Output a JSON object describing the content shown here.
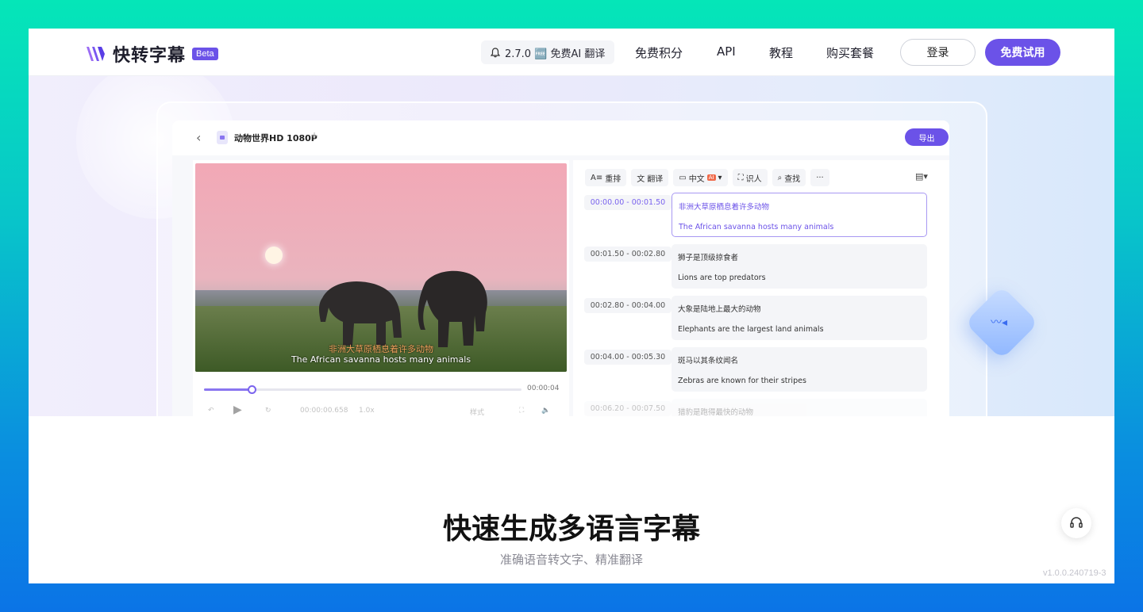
{
  "brand": {
    "name": "快转字幕",
    "badge": "Beta"
  },
  "nav": {
    "release": {
      "icon": "bell-icon",
      "text": "2.7.0 🆓 免费AI 翻译"
    },
    "links": [
      "免费积分",
      "API",
      "教程",
      "购买套餐"
    ],
    "login": "登录",
    "trial": "免费试用"
  },
  "editor": {
    "file_title": "动物世界HD 1080P",
    "export": "导出",
    "video": {
      "subtitle_cn": "非洲大草原栖息着许多动物",
      "subtitle_en": "The African savanna hosts many animals",
      "progress": 0.15,
      "total_time": "00:00:04",
      "current_time": "00:00:00.658",
      "speed": "1.0x",
      "style_label": "样式"
    },
    "toolbar": [
      {
        "icon": "reflow-icon",
        "label": "重排"
      },
      {
        "icon": "translate-icon",
        "label": "翻译"
      },
      {
        "icon": "subtitle-icon",
        "label": "中文",
        "tag": "AI"
      },
      {
        "icon": "speaker-id-icon",
        "label": "识人"
      },
      {
        "icon": "search-icon",
        "label": "查找"
      },
      {
        "icon": "more-icon",
        "label": "···"
      }
    ],
    "segments": [
      {
        "time": "00:00.00 - 00:01.50",
        "cn": "非洲大草原栖息着许多动物",
        "en": "The African savanna hosts many animals",
        "active": true
      },
      {
        "time": "00:01.50 - 00:02.80",
        "cn": "狮子是顶级掠食者",
        "en": "Lions are top predators",
        "active": false
      },
      {
        "time": "00:02.80 - 00:04.00",
        "cn": "大象是陆地上最大的动物",
        "en": "Elephants are the largest land animals",
        "active": false
      },
      {
        "time": "00:04.00 - 00:05.30",
        "cn": "斑马以其条纹闻名",
        "en": "Zebras are known for their stripes",
        "active": false
      },
      {
        "time": "00:06.20 - 00:07.50",
        "cn": "猎豹是跑得最快的动物",
        "en": "",
        "active": false
      }
    ]
  },
  "hero": {
    "headline": "快速生成多语言字幕",
    "subline": "准确语音转文字、精准翻译"
  },
  "version": "v1.0.0.240719-3",
  "colors": {
    "accent": "#6b52e8",
    "bg_top": "#05e6b8",
    "bg_bottom": "#0b74e6"
  }
}
